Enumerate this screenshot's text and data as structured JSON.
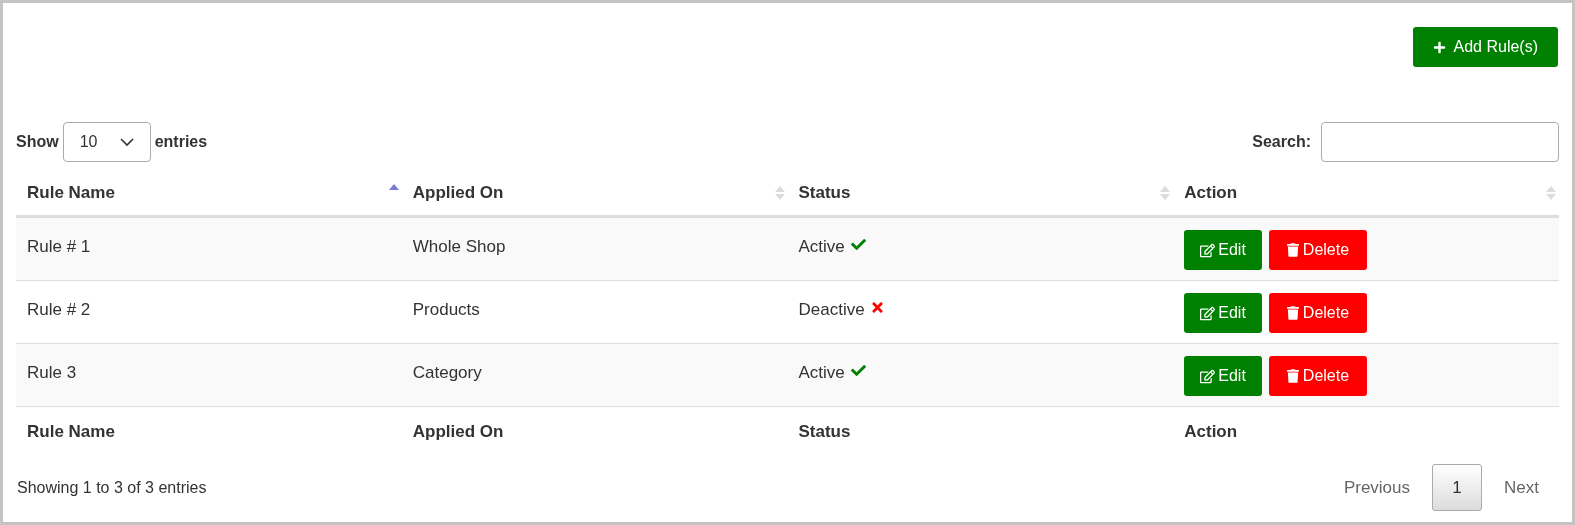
{
  "add_button": {
    "label": "Add Rule(s)"
  },
  "length": {
    "prefix": "Show",
    "value": "10",
    "suffix": "entries"
  },
  "search": {
    "label": "Search:"
  },
  "columns": [
    {
      "label": "Rule Name",
      "sorted": true
    },
    {
      "label": "Applied On",
      "sorted": false
    },
    {
      "label": "Status",
      "sorted": false
    },
    {
      "label": "Action",
      "sorted": false
    }
  ],
  "rows": [
    {
      "rule_name": "Rule # 1",
      "applied_on": "Whole Shop",
      "status": "Active",
      "active": true,
      "edit": "Edit",
      "delete": "Delete"
    },
    {
      "rule_name": "Rule # 2",
      "applied_on": "Products",
      "status": "Deactive",
      "active": false,
      "edit": "Edit",
      "delete": "Delete"
    },
    {
      "rule_name": "Rule 3",
      "applied_on": "Category",
      "status": "Active",
      "active": true,
      "edit": "Edit",
      "delete": "Delete"
    }
  ],
  "footer_columns": [
    "Rule Name",
    "Applied On",
    "Status",
    "Action"
  ],
  "info": "Showing 1 to 3 of 3 entries",
  "pagination": {
    "previous": "Previous",
    "pages": [
      {
        "label": "1",
        "selected": true
      }
    ],
    "next": "Next"
  }
}
